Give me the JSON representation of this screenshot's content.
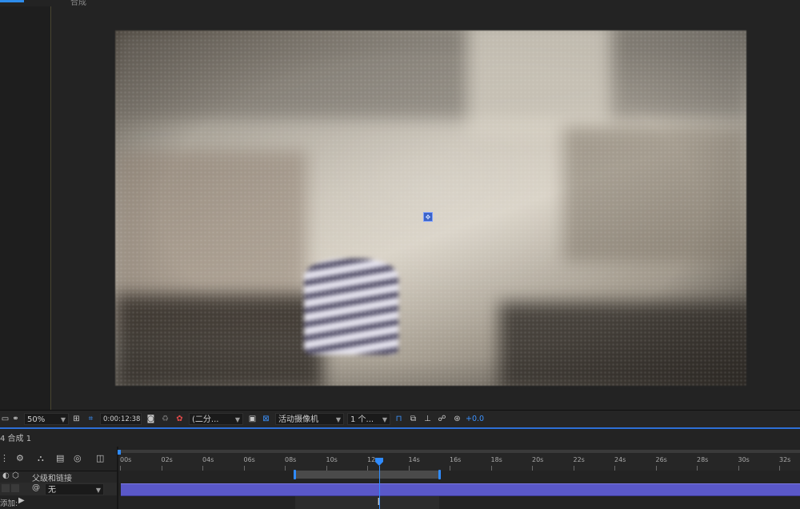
{
  "viewer": {
    "tab_label": "合成"
  },
  "toolbar": {
    "zoom": "50%",
    "timecode": "0:00:12:38",
    "resolution": "(二分...",
    "camera": "活动摄像机",
    "views": "1 个...",
    "exposure": "+0.0"
  },
  "timeline": {
    "comp_tab": "4 合成 1",
    "header_label": "父级和链接",
    "parent_value": "无",
    "add_label": "添加:",
    "ruler_labels": [
      "00s",
      "02s",
      "04s",
      "06s",
      "08s",
      "10s",
      "12s",
      "14s",
      "16s",
      "18s",
      "20s",
      "22s",
      "24s",
      "26s",
      "28s",
      "30s",
      "32s"
    ],
    "playhead_seconds": 12.6,
    "work_area_start": 8.5,
    "work_area_end": 15.5
  },
  "colors": {
    "accent": "#2f8bff",
    "layer_bar": "#5a58c8",
    "panel_bg": "#232323"
  },
  "icons": [
    "viewer-icon",
    "mask-icon",
    "grid-icon",
    "camera-snapshot-icon",
    "color-channel-icon",
    "transparency-grid-icon",
    "region-icon",
    "fast-preview-icon",
    "3d-view-icon",
    "flowchart-icon",
    "reset-exposure-icon",
    "solo-icon",
    "lock-icon",
    "motion-blur-icon",
    "graph-editor-icon",
    "stopwatch-icon"
  ]
}
